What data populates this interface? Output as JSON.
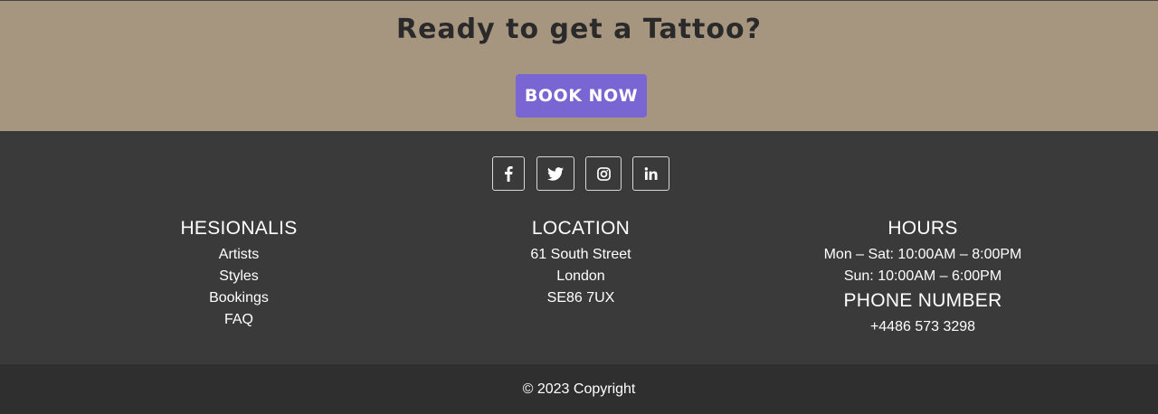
{
  "cta": {
    "title": "Ready to get a Tattoo?",
    "button_label": "BOOK NOW",
    "background": "#a7967f",
    "button_color": "#7966d3"
  },
  "social": [
    {
      "icon": "facebook-icon"
    },
    {
      "icon": "twitter-icon"
    },
    {
      "icon": "instagram-icon"
    },
    {
      "icon": "linkedin-icon"
    }
  ],
  "footer": {
    "background": "#3a3a3a",
    "brand": {
      "title": "HESIONALIS",
      "links": [
        "Artists",
        "Styles",
        "Bookings",
        "FAQ"
      ]
    },
    "location": {
      "title": "LOCATION",
      "lines": [
        "61 South Street",
        "London",
        "SE86 7UX"
      ]
    },
    "hours": {
      "title": "HOURS",
      "lines": [
        "Mon – Sat: 10:00AM – 8:00PM",
        "Sun: 10:00AM – 6:00PM"
      ],
      "phone_title": "PHONE NUMBER",
      "phone": "+4486 573 3298"
    }
  },
  "copyright": "© 2023 Copyright"
}
